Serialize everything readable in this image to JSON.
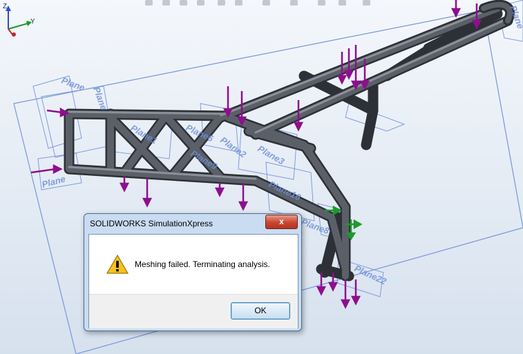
{
  "dialog": {
    "title": "SOLIDWORKS SimulationXpress",
    "close_label": "x",
    "message": "Meshing failed. Terminating analysis.",
    "ok_label": "OK"
  },
  "viewport": {
    "plane_labels": [
      "Plane",
      "Plane",
      "Plane1",
      "Plane6",
      "Plane9",
      "Plane2",
      "Plane3",
      "Plane16",
      "Plane8",
      "Plane",
      "Plane22",
      "Plane"
    ],
    "axis_labels": {
      "z": "Z",
      "y": "Y"
    }
  },
  "colors": {
    "frame_tube": "#4b4f55",
    "load_arrow": "#8e0f8e",
    "fixture_arrow": "#1c9a2a",
    "plane": "#6f8fd6",
    "background_top": "#f3f6fa",
    "background_bottom": "#d7e2ef"
  }
}
